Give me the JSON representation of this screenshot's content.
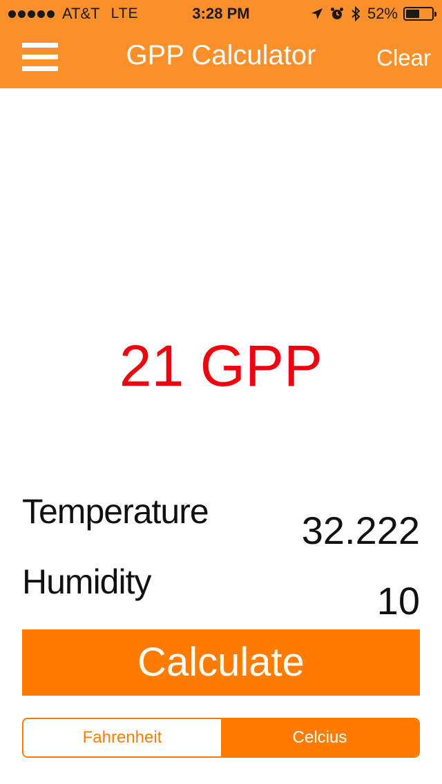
{
  "status_bar": {
    "carrier": "AT&T",
    "network": "LTE",
    "time": "3:28 PM",
    "battery_percent": "52%",
    "battery_level": 0.52,
    "icons": [
      "signal-dots-icon",
      "location-arrow-icon",
      "alarm-icon",
      "bluetooth-icon",
      "battery-icon"
    ]
  },
  "nav": {
    "title": "GPP Calculator",
    "clear_label": "Clear",
    "menu_icon": "hamburger-menu-icon"
  },
  "result": {
    "text": "21 GPP"
  },
  "inputs": {
    "temperature": {
      "label": "Temperature",
      "value": "32.222"
    },
    "humidity": {
      "label": "Humidity",
      "value": "10"
    }
  },
  "calculate": {
    "label": "Calculate"
  },
  "units": {
    "options": [
      "Fahrenheit",
      "Celcius"
    ],
    "selected": "Celcius"
  },
  "colors": {
    "accent": "#ff7c00",
    "bar": "#fb8f2a",
    "result": "#f2000d"
  }
}
